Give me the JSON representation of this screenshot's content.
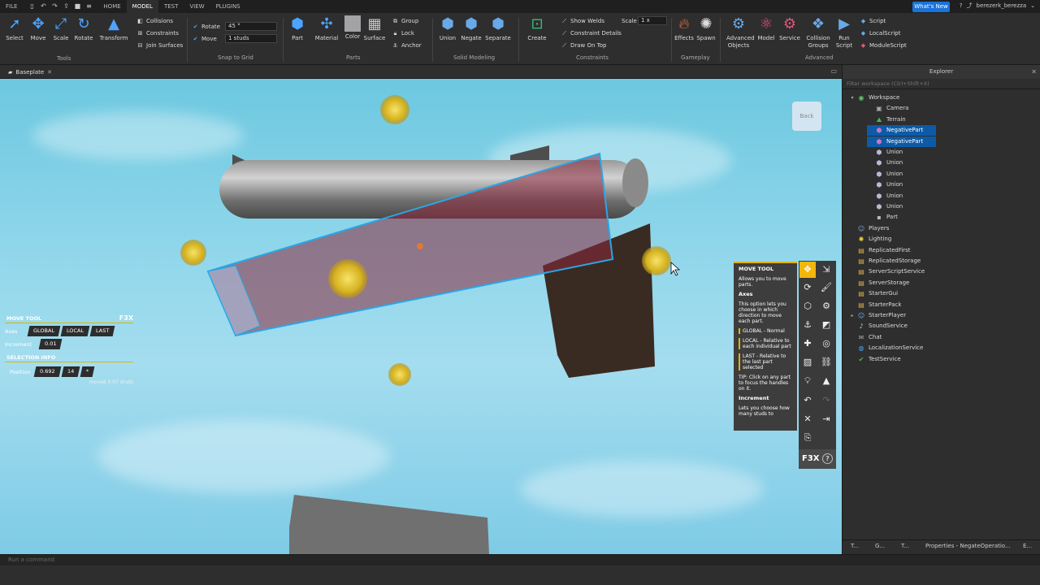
{
  "menubar": {
    "file": "FILE",
    "tabs": [
      "HOME",
      "MODEL",
      "TEST",
      "VIEW",
      "PLUGINS"
    ],
    "active_tab": "MODEL",
    "whats_new": "What's New",
    "username": "berezerk_berezza"
  },
  "ribbon": {
    "tools": {
      "group": "Tools",
      "select": "Select",
      "move": "Move",
      "scale": "Scale",
      "rotate": "Rotate",
      "transform": "Transform"
    },
    "collisions": {
      "collisions": "Collisions",
      "constraints": "Constraints",
      "join_surfaces": "Join Surfaces"
    },
    "snap": {
      "group": "Snap to Grid",
      "rotate_label": "Rotate",
      "rotate_value": "45 °",
      "move_label": "Move",
      "move_value": "1 studs"
    },
    "parts": {
      "group": "Parts",
      "part": "Part",
      "material": "Material",
      "color": "Color",
      "surface": "Surface",
      "group_btn": "Group",
      "lock": "Lock",
      "anchor": "Anchor"
    },
    "solid": {
      "group": "Solid Modeling",
      "union": "Union",
      "negate": "Negate",
      "separate": "Separate"
    },
    "constraints": {
      "group": "Constraints",
      "create": "Create",
      "show_welds": "Show Welds",
      "constraint_details": "Constraint Details",
      "draw_on_top": "Draw On Top",
      "scale_label": "Scale",
      "scale_value": "1 x"
    },
    "gameplay": {
      "group": "Gameplay",
      "effects": "Effects",
      "spawn": "Spawn"
    },
    "advanced": {
      "group": "Advanced",
      "advanced_objects": "Advanced Objects",
      "model": "Model",
      "service": "Service",
      "collision_groups": "Collision Groups",
      "run_script": "Run Script",
      "script": "Script",
      "local_script": "LocalScript",
      "module_script": "ModuleScript"
    }
  },
  "doc_tab": {
    "label": "Baseplate"
  },
  "viewcube": {
    "label": "Back"
  },
  "f3x_info": {
    "title": "MOVE TOOL",
    "hotkey": "F3X",
    "axes_label": "Axes",
    "axes": [
      "GLOBAL",
      "LOCAL",
      "LAST"
    ],
    "increment_label": "Increment",
    "increment_value": "0.01",
    "selection_title": "SELECTION INFO",
    "position_label": "Position",
    "position": [
      "0.692",
      "14",
      "*"
    ],
    "moved": "moved 0.07 studs"
  },
  "f3x_help": {
    "title": "MOVE TOOL",
    "intro": "Allows you to move parts.",
    "axes_h": "Axes",
    "axes_desc": "This option lets you choose in which direction to move each part.",
    "global": "GLOBAL - Normal",
    "local": "LOCAL - Relative to each individual part",
    "last": "LAST - Relative to the last part selected",
    "tip": "TIP: Click on any part to focus the handles on it.",
    "increment_h": "Increment",
    "increment_desc": "Lets you choose how many studs to"
  },
  "f3x_tools": {
    "logo": "F3X",
    "help": "?"
  },
  "explorer": {
    "title": "Explorer",
    "filter_placeholder": "Filter workspace (Ctrl+Shift+X)",
    "items": [
      {
        "label": "Workspace",
        "depth": 0,
        "icon": "workspace-icon",
        "expand": "▾"
      },
      {
        "label": "Camera",
        "depth": 1,
        "icon": "camera-icon"
      },
      {
        "label": "Terrain",
        "depth": 1,
        "icon": "terrain-icon"
      },
      {
        "label": "NegativePart",
        "depth": 1,
        "icon": "negate-icon",
        "selected": true
      },
      {
        "label": "NegativePart",
        "depth": 1,
        "icon": "negate-icon",
        "selected": true
      },
      {
        "label": "Union",
        "depth": 1,
        "icon": "union-icon"
      },
      {
        "label": "Union",
        "depth": 1,
        "icon": "union-icon"
      },
      {
        "label": "Union",
        "depth": 1,
        "icon": "union-icon"
      },
      {
        "label": "Union",
        "depth": 1,
        "icon": "union-icon"
      },
      {
        "label": "Union",
        "depth": 1,
        "icon": "union-icon"
      },
      {
        "label": "Union",
        "depth": 1,
        "icon": "union-icon"
      },
      {
        "label": "Part",
        "depth": 1,
        "icon": "part-icon"
      },
      {
        "label": "Players",
        "depth": 0,
        "icon": "players-icon"
      },
      {
        "label": "Lighting",
        "depth": 0,
        "icon": "lighting-icon"
      },
      {
        "label": "ReplicatedFirst",
        "depth": 0,
        "icon": "replicated-first-icon"
      },
      {
        "label": "ReplicatedStorage",
        "depth": 0,
        "icon": "replicated-storage-icon"
      },
      {
        "label": "ServerScriptService",
        "depth": 0,
        "icon": "server-script-service-icon"
      },
      {
        "label": "ServerStorage",
        "depth": 0,
        "icon": "server-storage-icon"
      },
      {
        "label": "StarterGui",
        "depth": 0,
        "icon": "starter-gui-icon"
      },
      {
        "label": "StarterPack",
        "depth": 0,
        "icon": "starter-pack-icon"
      },
      {
        "label": "StarterPlayer",
        "depth": 0,
        "icon": "starter-player-icon",
        "expand": "▸"
      },
      {
        "label": "SoundService",
        "depth": 0,
        "icon": "sound-service-icon"
      },
      {
        "label": "Chat",
        "depth": 0,
        "icon": "chat-icon"
      },
      {
        "label": "LocalizationService",
        "depth": 0,
        "icon": "localization-icon"
      },
      {
        "label": "TestService",
        "depth": 0,
        "icon": "test-service-icon"
      }
    ],
    "bottom_tabs": [
      "T...",
      "G...",
      "T...",
      "Properties - NegateOperatio...",
      "E..."
    ]
  },
  "command_bar": {
    "placeholder": "Run a command"
  },
  "colors": {
    "accent": "#f2b60f",
    "selection": "#0d5aa7",
    "whats_new": "#1a73d9"
  }
}
